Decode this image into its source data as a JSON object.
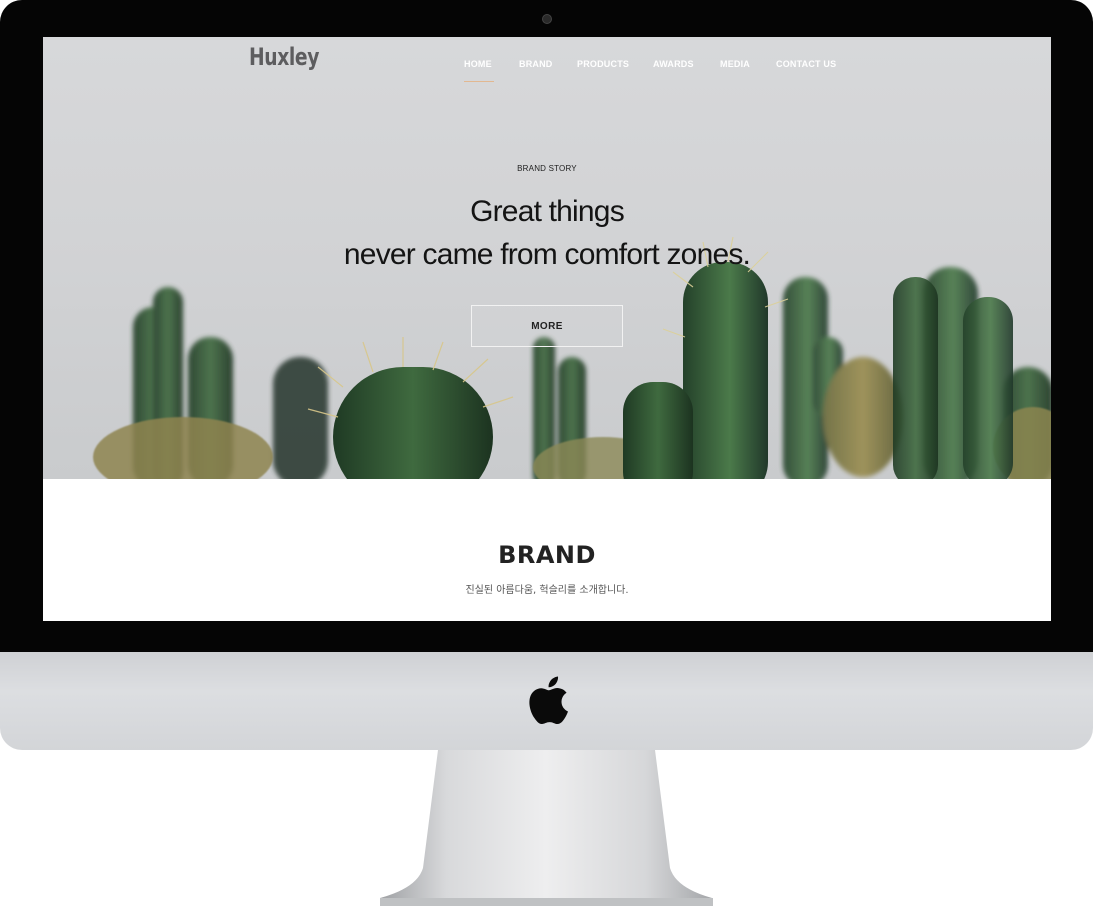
{
  "header": {
    "logo": "Huxley",
    "nav": [
      "HOME",
      "BRAND",
      "PRODUCTS",
      "AWARDS",
      "MEDIA",
      "CONTACT US"
    ],
    "active_nav": "HOME",
    "accent_color": "#e2b891"
  },
  "hero": {
    "eyebrow": "BRAND STORY",
    "headline_line1": "Great things",
    "headline_line2": "never came from comfort zones.",
    "button": "MORE",
    "background": "cactus photo"
  },
  "brand": {
    "title": "BRAND",
    "subtitle": "진실된 아름다움, 헉슬리를 소개합니다."
  },
  "device": {
    "logo_icon": "apple-logo-icon"
  }
}
